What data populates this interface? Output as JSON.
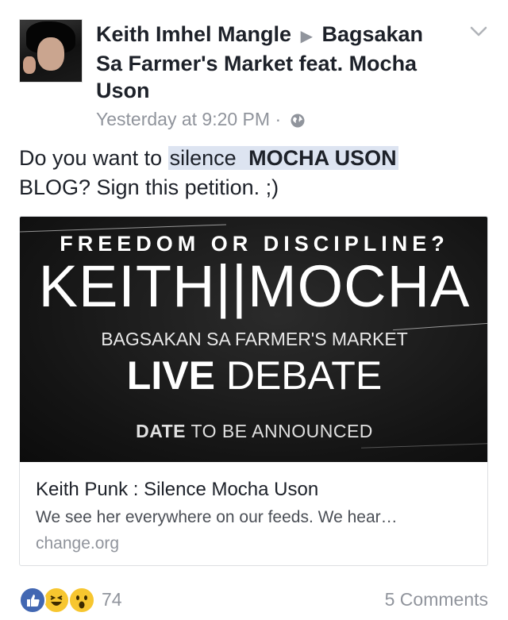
{
  "post": {
    "author": "Keith Imhel Mangle",
    "arrow": "▶",
    "target": "Bagsakan Sa Farmer's Market feat. Mocha Uson",
    "time": "Yesterday at 9:20 PM",
    "separator": "·",
    "privacy_icon": "globe-icon",
    "text_prefix": "Do you want to ",
    "text_highlight_1": "silence",
    "text_highlight_2": "MOCHA USON",
    "text_line2_bold": "BLOG",
    "text_suffix": "? Sign this petition. ;)"
  },
  "link_card": {
    "image": {
      "line1": "FREEDOM OR DISCIPLINE?",
      "line2": "KEITH||MOCHA",
      "line3": "BAGSAKAN SA FARMER'S MARKET",
      "live_bold": "LIVE",
      "live_thin": "DEBATE",
      "date_bold": "DATE",
      "date_rest": "TO BE ANNOUNCED"
    },
    "title": "Keith Punk : Silence Mocha Uson",
    "description": "We see her everywhere on our feeds. We hear…",
    "domain": "change.org"
  },
  "footer": {
    "reactions": [
      "like-icon",
      "haha-icon",
      "wow-icon"
    ],
    "reaction_count": "74",
    "comments": "5 Comments"
  },
  "colors": {
    "text": "#1d2129",
    "muted": "#90949c",
    "highlight": "#dde4f1",
    "like_blue": "#4267b2",
    "emoji_yellow": "#f7c62f"
  }
}
